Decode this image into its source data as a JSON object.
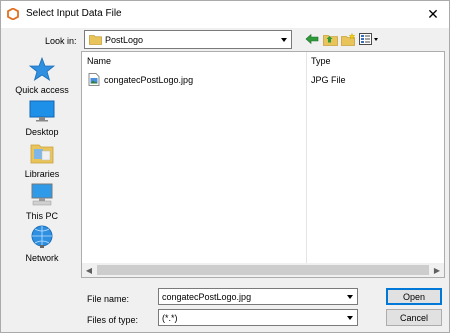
{
  "window": {
    "title": "Select Input Data File"
  },
  "toolbar": {
    "look_in_label": "Look in:",
    "look_in_value": "PostLogo"
  },
  "places": [
    {
      "label": "Quick access",
      "icon": "star-icon"
    },
    {
      "label": "Desktop",
      "icon": "desktop-icon"
    },
    {
      "label": "Libraries",
      "icon": "libraries-icon"
    },
    {
      "label": "This PC",
      "icon": "computer-icon"
    },
    {
      "label": "Network",
      "icon": "network-icon"
    }
  ],
  "file_list": {
    "columns": [
      "Name",
      "Type"
    ],
    "rows": [
      {
        "name": "congatecPostLogo.jpg",
        "type": "JPG File",
        "icon": "image-file-icon"
      }
    ]
  },
  "form": {
    "file_name_label": "File name:",
    "file_name_value": "congatecPostLogo.jpg",
    "files_of_type_label": "Files of type:",
    "files_of_type_value": "(*.*)"
  },
  "buttons": {
    "open": "Open",
    "cancel": "Cancel"
  },
  "colors": {
    "accent": "#0078d7",
    "folder": "#e8c45a"
  }
}
